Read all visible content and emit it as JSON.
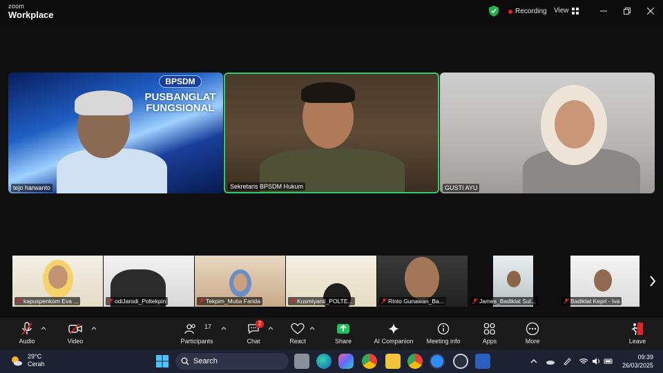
{
  "titlebar": {
    "logo_line1": "zoom",
    "logo_line2": "Workplace",
    "recording": "Recording",
    "view": "View"
  },
  "speakers": [
    {
      "name": "tejo harwanto",
      "background_banner_top": "BPSDM",
      "background_banner_bottom": "PUSBANGLAT FUNGSIONAL"
    },
    {
      "name": "Sekretaris BPSDM Hukum",
      "active_speaker": true
    },
    {
      "name": "GUSTI AYU"
    }
  ],
  "strip": [
    {
      "name": "kapuspenkom Eva ..."
    },
    {
      "name": "odiJarodi_Poltekpin"
    },
    {
      "name": "Tekpim_Mutia Farida"
    },
    {
      "name": "Kusmiyanti_POLTE..."
    },
    {
      "name": "Rinto Gunawan_Ba..."
    },
    {
      "name": "James_Badiklat Sul..."
    },
    {
      "name": "Badiklat Kepri - Iva"
    }
  ],
  "toolbar": {
    "audio": "Audio",
    "video": "Video",
    "participants": "Participants",
    "participants_count": "17",
    "chat": "Chat",
    "chat_badge": "2",
    "react": "React",
    "share": "Share",
    "ai_companion": "AI Companion",
    "meeting_info": "Meeting info",
    "apps": "Apps",
    "more": "More",
    "leave": "Leave"
  },
  "taskbar": {
    "temperature": "29°C",
    "condition": "Cerah",
    "search_placeholder": "Search",
    "time": "09:39",
    "date": "26/03/2025"
  },
  "colors": {
    "active_speaker_border": "#2ecc71",
    "recording_dot": "#e02424",
    "share_icon": "#1fbf5b",
    "leave_icon": "#e02424"
  }
}
